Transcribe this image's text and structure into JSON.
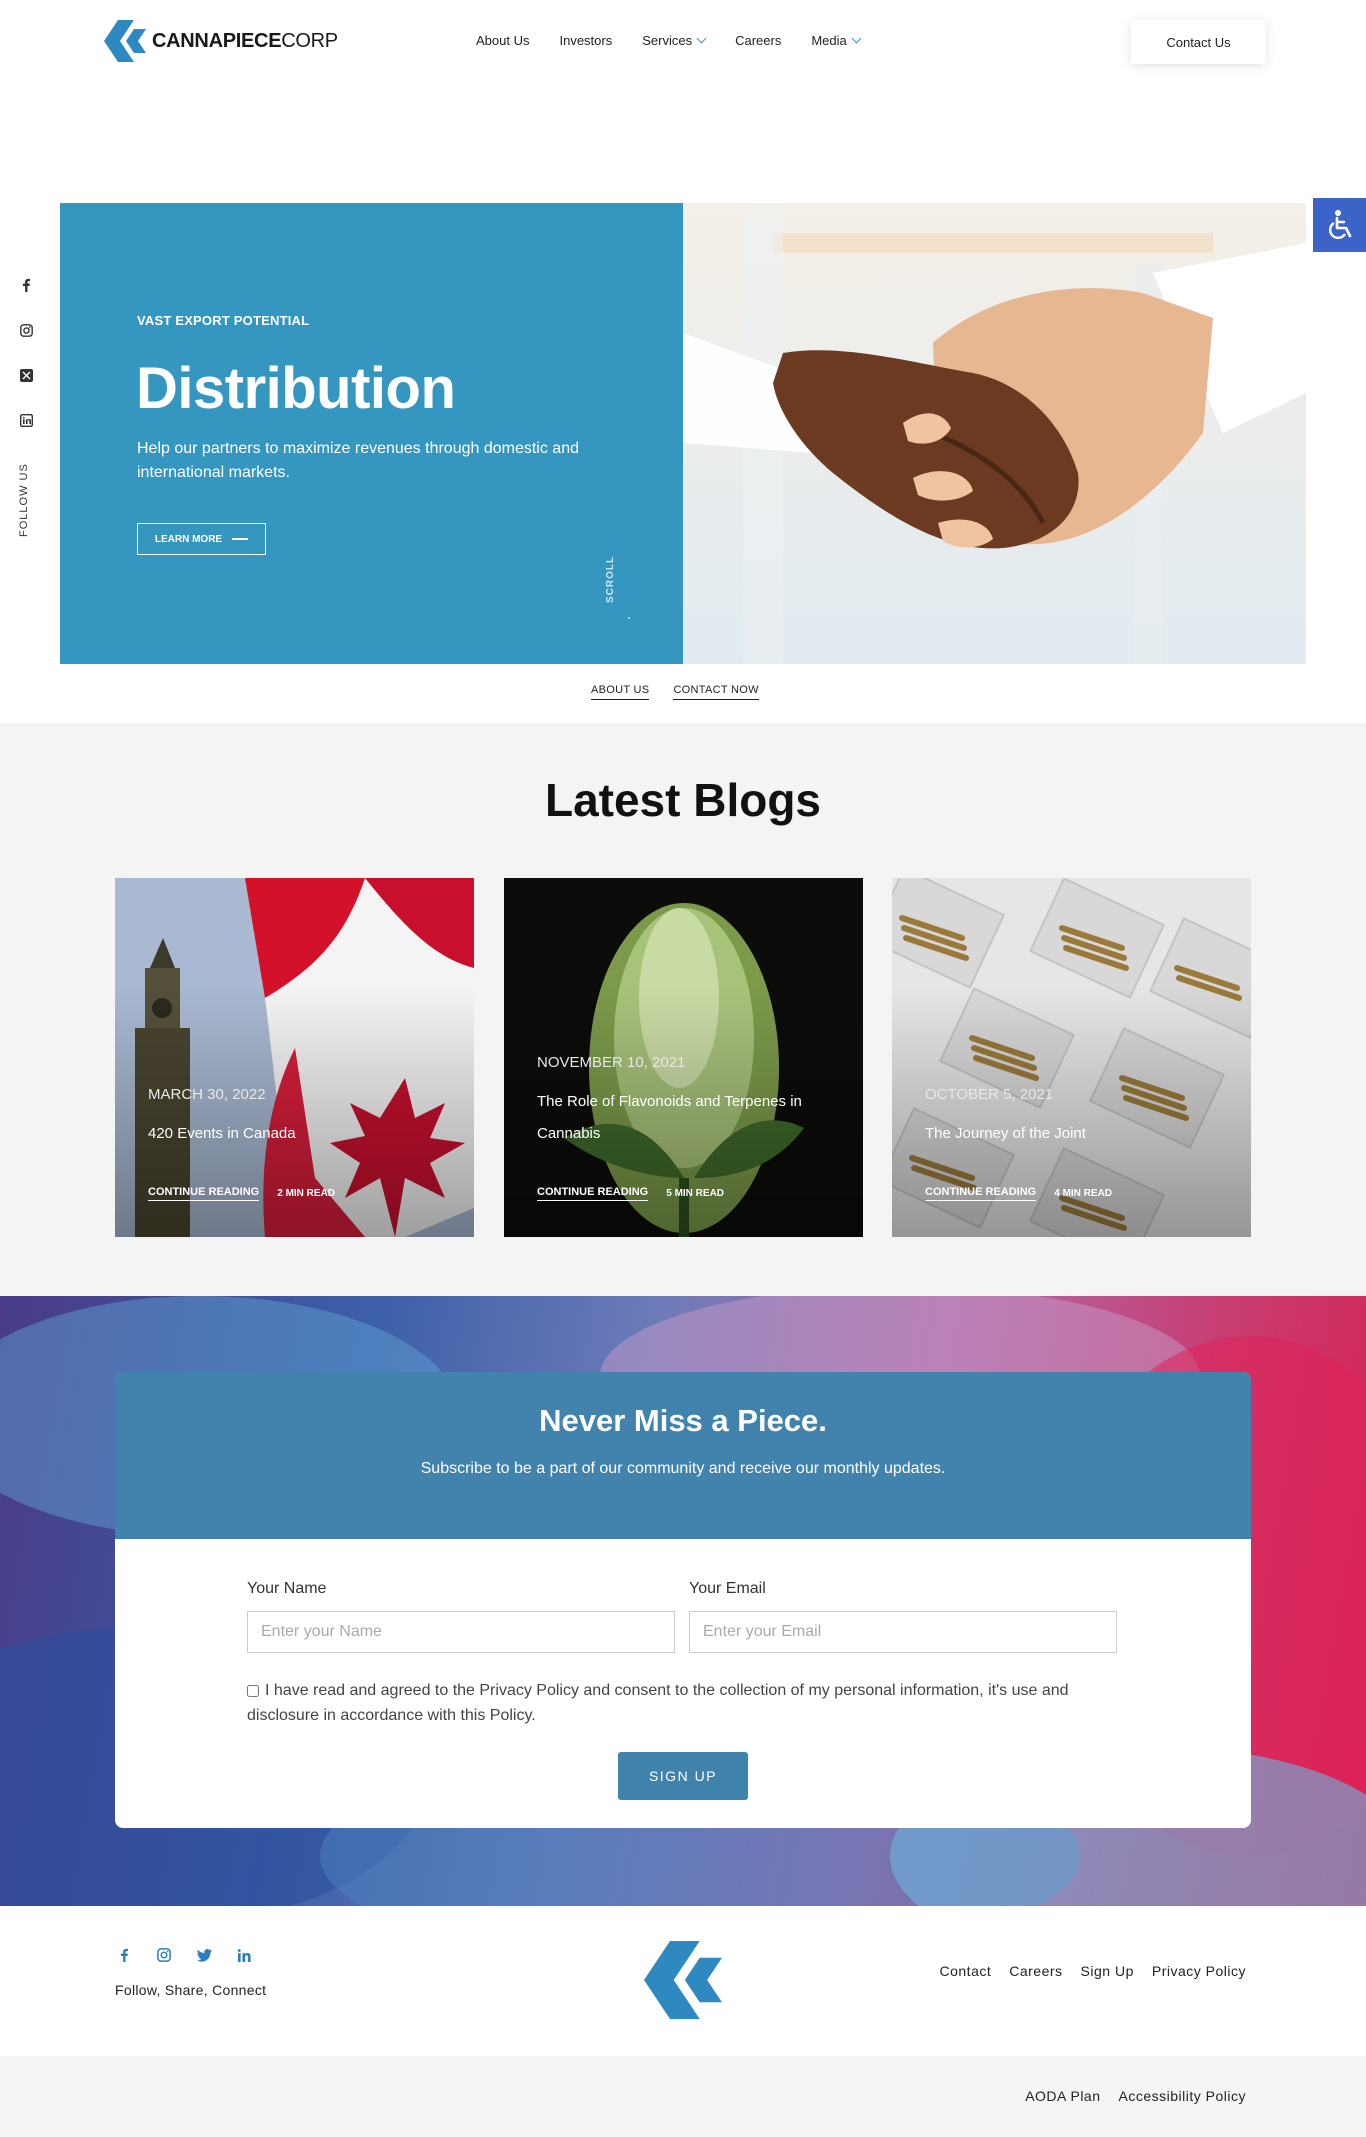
{
  "brand": {
    "name_bold": "CANNAPIECE",
    "name_light": "CORP",
    "color": "#2e89c0"
  },
  "nav": {
    "items": [
      {
        "label": "About Us",
        "dropdown": false
      },
      {
        "label": "Investors",
        "dropdown": false
      },
      {
        "label": "Services",
        "dropdown": true
      },
      {
        "label": "Careers",
        "dropdown": false
      },
      {
        "label": "Media",
        "dropdown": true
      }
    ],
    "contact_label": "Contact Us"
  },
  "accessibility": {
    "icon": "wheelchair-icon",
    "color": "#3c63c7"
  },
  "side_social": {
    "icons": [
      "facebook-icon",
      "instagram-icon",
      "x-twitter-icon",
      "linkedin-icon"
    ],
    "follow_label": "FOLLOW US"
  },
  "hero": {
    "eyebrow": "VAST EXPORT POTENTIAL",
    "title": "Distribution",
    "description": "Help our partners to maximize revenues through domestic and international markets.",
    "cta_label": "LEARN MORE",
    "scroll_label": "SCROLL",
    "panel_color": "#3596c0"
  },
  "under_hero_links": {
    "about": "ABOUT US",
    "contact": "CONTACT NOW"
  },
  "blogs": {
    "title": "Latest Blogs",
    "cards": [
      {
        "date": "MARCH 30, 2022",
        "title": "420 Events in Canada",
        "cta": "CONTINUE READING",
        "read_time": "2 MIN READ"
      },
      {
        "date": "NOVEMBER 10, 2021",
        "title": "The Role of Flavonoids and Terpenes in Cannabis",
        "cta": "CONTINUE READING",
        "read_time": "5 MIN READ"
      },
      {
        "date": "OCTOBER 5, 2021",
        "title": "The Journey of the Joint",
        "cta": "CONTINUE READING",
        "read_time": "4 MIN READ"
      }
    ]
  },
  "subscribe": {
    "title": "Never Miss a Piece.",
    "description": "Subscribe to be a part of our community and receive our monthly updates.",
    "name_label": "Your Name",
    "name_placeholder": "Enter your Name",
    "email_label": "Your Email",
    "email_placeholder": "Enter your Email",
    "consent": "I have read and agreed to the Privacy Policy and consent to the collection of my personal information, it's use and disclosure in accordance with this Policy.",
    "button": "SIGN UP",
    "header_color": "#4183ad"
  },
  "footer": {
    "social_icons": [
      "facebook-icon",
      "instagram-icon",
      "twitter-icon",
      "linkedin-icon"
    ],
    "follow_text": "Follow, Share, Connect",
    "links": [
      "Contact",
      "Careers",
      "Sign Up",
      "Privacy Policy"
    ],
    "bottom_links": [
      "AODA Plan",
      "Accessibility Policy"
    ]
  }
}
